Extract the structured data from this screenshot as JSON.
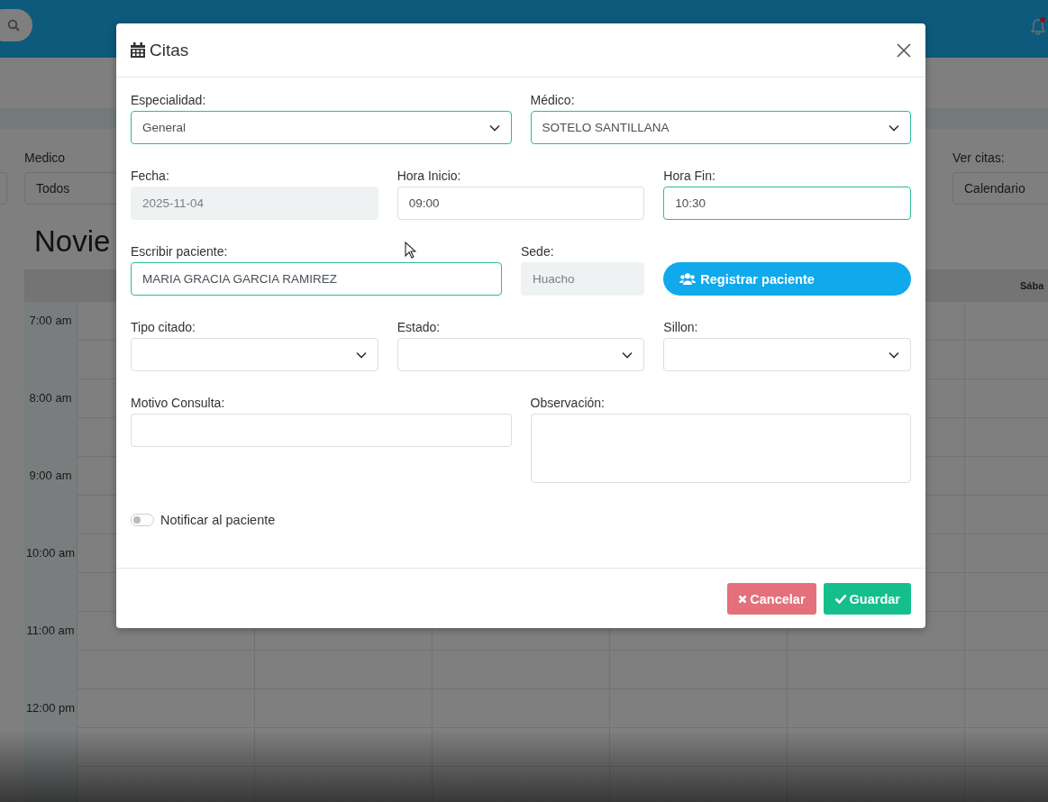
{
  "background": {
    "filters": [
      {
        "label": "Medico",
        "value": "Todos"
      },
      {
        "label": "Ver citas:",
        "value": "Calendario"
      }
    ],
    "calendar": {
      "title": "Novie",
      "day_header": "Sába",
      "times": [
        "7:00 am",
        "8:00 am",
        "9:00 am",
        "10:00 am",
        "11:00 am",
        "12:00 pm"
      ]
    }
  },
  "modal": {
    "title": "Citas",
    "rows": [
      [
        {
          "kind": "select",
          "label": "Especialidad:",
          "value": "General",
          "valid": true,
          "disabled": false
        },
        {
          "kind": "select",
          "label": "Médico:",
          "value": "SOTELO SANTILLANA",
          "valid": true,
          "disabled": false
        }
      ],
      [
        {
          "kind": "input",
          "label": "Fecha:",
          "value": "2025-11-04",
          "valid": false,
          "disabled": true
        },
        {
          "kind": "input",
          "label": "Hora Inicio:",
          "value": "09:00",
          "valid": false,
          "disabled": false
        },
        {
          "kind": "input",
          "label": "Hora Fin:",
          "value": "10:30",
          "valid": true,
          "disabled": false
        }
      ],
      [
        {
          "kind": "input",
          "label": "Escribir paciente:",
          "value": "MARIA GRACIA GARCIA RAMIREZ",
          "valid": true,
          "disabled": false
        },
        {
          "kind": "input",
          "label": "Sede:",
          "value": "Huacho",
          "valid": false,
          "disabled": true
        },
        {
          "kind": "button",
          "label": "Registrar paciente"
        }
      ],
      [
        {
          "kind": "select",
          "label": "Tipo citado:",
          "valid": false,
          "disabled": false
        },
        {
          "kind": "select",
          "label": "Estado:",
          "valid": false,
          "disabled": false
        },
        {
          "kind": "select",
          "label": "Sillon:",
          "valid": false,
          "disabled": false
        }
      ],
      [
        {
          "kind": "input",
          "label": "Motivo Consulta:",
          "valid": false,
          "disabled": false
        },
        {
          "kind": "textarea",
          "label": "Observación:",
          "valid": false,
          "disabled": false
        }
      ]
    ],
    "toggle": {
      "label": "Notificar al paciente",
      "on": false
    },
    "buttons": [
      {
        "kind": "cancel",
        "label": "Cancelar"
      },
      {
        "kind": "save",
        "label": "Guardar"
      }
    ]
  }
}
